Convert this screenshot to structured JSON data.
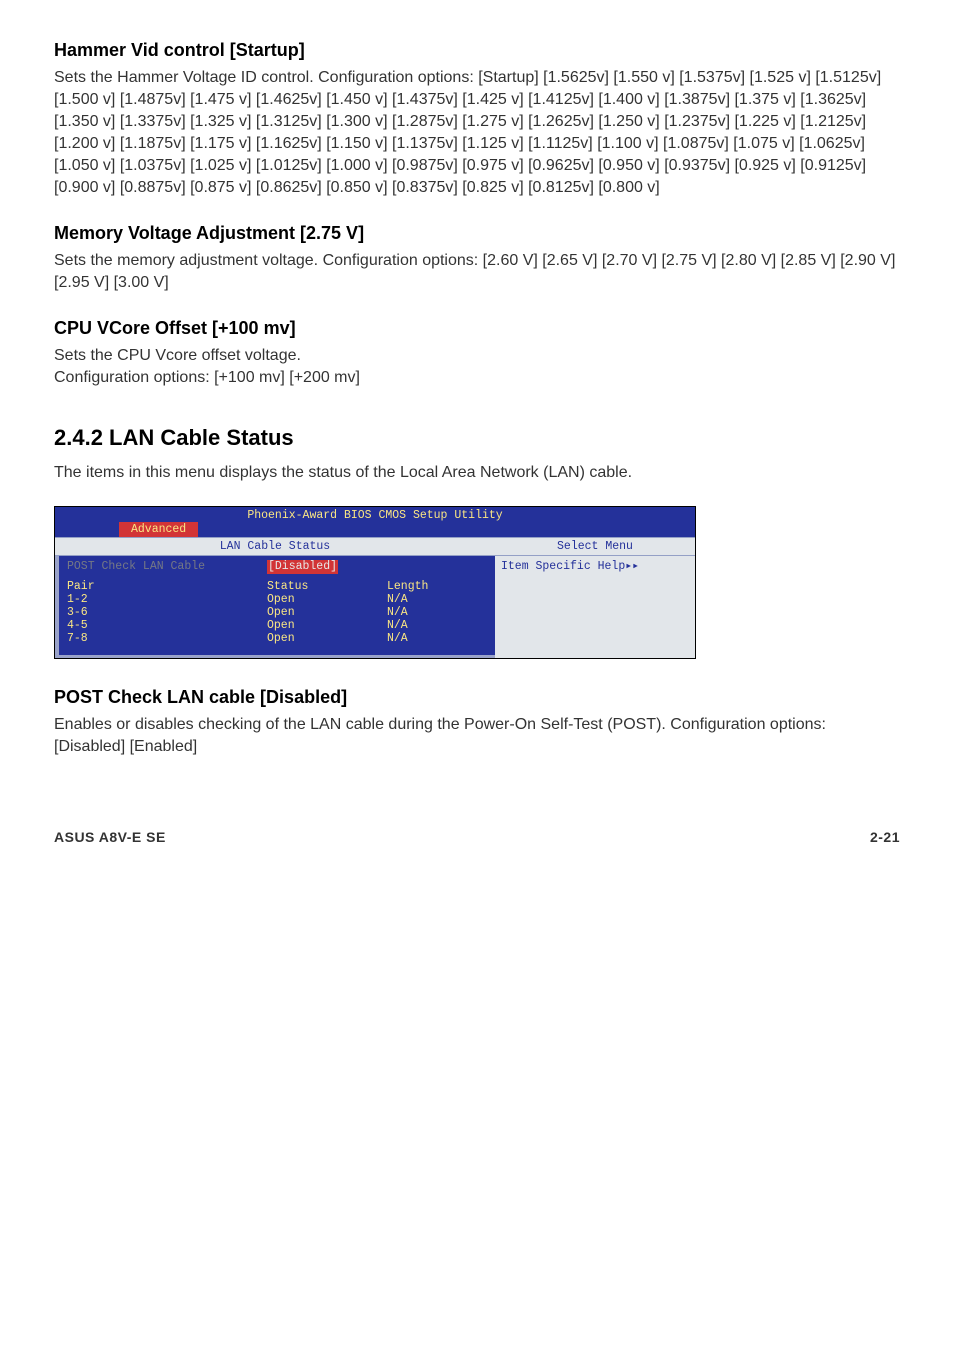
{
  "s1": {
    "heading": "Hammer Vid control [Startup]",
    "body": "Sets the Hammer Voltage ID control. Configuration options: [Startup] [1.5625v] [1.550 v] [1.5375v] [1.525 v] [1.5125v] [1.500 v] [1.4875v] [1.475 v] [1.4625v] [1.450 v] [1.4375v] [1.425 v] [1.4125v] [1.400 v] [1.3875v] [1.375 v] [1.3625v] [1.350 v] [1.3375v] [1.325 v] [1.3125v] [1.300 v] [1.2875v] [1.275 v] [1.2625v] [1.250 v] [1.2375v] [1.225 v] [1.2125v] [1.200 v] [1.1875v] [1.175 v] [1.1625v] [1.150 v] [1.1375v] [1.125 v] [1.1125v] [1.100 v] [1.0875v] [1.075 v] [1.0625v] [1.050 v] [1.0375v] [1.025 v] [1.0125v] [1.000 v] [0.9875v] [0.975 v] [0.9625v] [0.950 v] [0.9375v] [0.925 v] [0.9125v] [0.900 v] [0.8875v] [0.875 v] [0.8625v] [0.850 v] [0.8375v] [0.825 v] [0.8125v] [0.800 v]"
  },
  "s2": {
    "heading": "Memory Voltage Adjustment [2.75 V]",
    "body": "Sets the memory adjustment voltage. Configuration options: [2.60 V] [2.65 V] [2.70 V] [2.75 V] [2.80 V] [2.85 V] [2.90 V] [2.95 V] [3.00 V]"
  },
  "s3": {
    "heading": "CPU VCore Offset [+100 mv]",
    "body": "Sets the CPU Vcore offset voltage.\nConfiguration options: [+100 mv] [+200 mv]"
  },
  "section": {
    "heading": "2.4.2   LAN Cable Status",
    "intro": "The items in this menu displays the status of the Local Area Network (LAN) cable."
  },
  "bios": {
    "title": "Phoenix-Award BIOS CMOS Setup Utility",
    "tab": "Advanced",
    "panel_title": "LAN Cable Status",
    "right_title": "Select Menu",
    "right_help": "Item Specific Help",
    "setting_label": "POST Check LAN Cable",
    "setting_value": "[Disabled]",
    "col_pair": "Pair",
    "col_status": "Status",
    "col_length": "Length",
    "rows": {
      "r0": {
        "pair": "1-2",
        "status": "Open",
        "length": "N/A"
      },
      "r1": {
        "pair": "3-6",
        "status": "Open",
        "length": "N/A"
      },
      "r2": {
        "pair": "4-5",
        "status": "Open",
        "length": "N/A"
      },
      "r3": {
        "pair": "7-8",
        "status": "Open",
        "length": "N/A"
      }
    }
  },
  "s4": {
    "heading": "POST Check LAN cable [Disabled]",
    "body": "Enables or disables checking of the LAN cable during the Power-On Self-Test (POST). Configuration options: [Disabled] [Enabled]"
  },
  "footer": {
    "left": "ASUS A8V-E SE",
    "right": "2-21"
  }
}
